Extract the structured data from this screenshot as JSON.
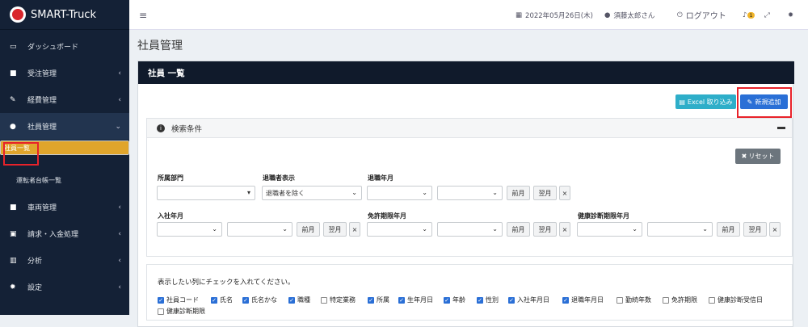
{
  "brand": {
    "name": "SMART-Truck"
  },
  "sidebar": {
    "items": [
      {
        "label": "ダッシュボード",
        "icon": "monitor-icon"
      },
      {
        "label": "受注管理",
        "icon": "truck-icon"
      },
      {
        "label": "経費管理",
        "icon": "edit-icon"
      },
      {
        "label": "社員管理",
        "icon": "user-icon"
      },
      {
        "label": "社員一覧"
      },
      {
        "label": "運転者台帳一覧"
      },
      {
        "label": "車両管理",
        "icon": "truck-icon"
      },
      {
        "label": "請求・入金処理",
        "icon": "money-icon"
      },
      {
        "label": "分析",
        "icon": "chart-icon"
      },
      {
        "label": "設定",
        "icon": "gear-icon"
      }
    ]
  },
  "topbar": {
    "date": "2022年05月26日(木)",
    "user": "須藤太郎さん",
    "logout": "ログアウト",
    "notif_count": "1"
  },
  "page": {
    "title": "社員管理"
  },
  "card": {
    "title": "社員 一覧"
  },
  "buttons": {
    "excel": "Excel 取り込み",
    "add": "新規追加",
    "reset": "リセット"
  },
  "search": {
    "title": "検索条件",
    "dept_label": "所属部門",
    "retired_label": "退職者表示",
    "retired_value": "退職者を除く",
    "retire_ym_label": "退職年月",
    "join_ym_label": "入社年月",
    "license_label": "免許期限年月",
    "health_label": "健康診断期限年月",
    "prev": "前月",
    "next": "翌月",
    "clear": "×"
  },
  "columns": {
    "intro": "表示したい列にチェックを入れてください。",
    "items": [
      {
        "label": "社員コード",
        "checked": true
      },
      {
        "label": "氏名",
        "checked": true
      },
      {
        "label": "氏名かな",
        "checked": true
      },
      {
        "label": "職種",
        "checked": true
      },
      {
        "label": "特定業務",
        "checked": false
      },
      {
        "label": "所属",
        "checked": true
      },
      {
        "label": "生年月日",
        "checked": true
      },
      {
        "label": "年齢",
        "checked": true
      },
      {
        "label": "性別",
        "checked": true
      },
      {
        "label": "入社年月日",
        "checked": true
      },
      {
        "label": "退職年月日",
        "checked": true
      },
      {
        "label": "勤続年数",
        "checked": false
      },
      {
        "label": "免許期限",
        "checked": false
      },
      {
        "label": "健康診断受信日",
        "checked": false
      },
      {
        "label": "健康診断期限",
        "checked": false
      }
    ]
  },
  "colors": {
    "sidebar": "#142136",
    "accent": "#e0a52c",
    "highlight": "#e8222a",
    "primary": "#2a6fd6",
    "info": "#2eaec9"
  }
}
